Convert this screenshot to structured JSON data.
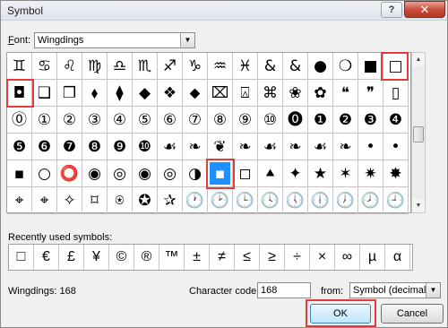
{
  "window": {
    "title": "Symbol",
    "help_label": "?",
    "close_label": "✕"
  },
  "font": {
    "label_accel": "F",
    "label_rest": "ont:",
    "value": "Wingdings",
    "dropdown_arrow": "▼"
  },
  "grid": {
    "rows": [
      [
        "♊",
        "♋",
        "♌",
        "♍",
        "♎",
        "♏",
        "♐",
        "♑",
        "♒",
        "♓",
        "&",
        "&",
        "●",
        "❍",
        "■",
        "□"
      ],
      [
        "◘",
        "❑",
        "❒",
        "⬧",
        "⧫",
        "◆",
        "❖",
        "⬥",
        "⌧",
        "⍓",
        "⌘",
        "❀",
        "✿",
        "❝",
        "❞",
        "▯"
      ],
      [
        "⓪",
        "①",
        "②",
        "③",
        "④",
        "⑤",
        "⑥",
        "⑦",
        "⑧",
        "⑨",
        "⑩",
        "⓿",
        "❶",
        "❷",
        "❸",
        "❹"
      ],
      [
        "❺",
        "❻",
        "❼",
        "❽",
        "❾",
        "❿",
        "☙",
        "❧",
        "❦",
        "❧",
        "☙",
        "❧",
        "☙",
        "❧",
        "•",
        "•"
      ],
      [
        "▪",
        "○",
        "⭕",
        "◉",
        "◎",
        "◉",
        "◎",
        "◑",
        "▪",
        "◻",
        "⯅",
        "✦",
        "★",
        "✶",
        "✷",
        "✸",
        "✹"
      ],
      [
        "⌖",
        "⌖",
        "✧",
        "⌑",
        "⍟",
        "✪",
        "✰",
        "🕐",
        "🕑",
        "🕒",
        "🕓",
        "🕔",
        "🕕",
        "🕖",
        "🕗",
        "🕘"
      ]
    ],
    "selected": {
      "row": 4,
      "col": 8
    }
  },
  "scrollbar": {
    "up_arrow": "▲",
    "down_arrow": "▼"
  },
  "recent": {
    "label": "Recently used symbols:",
    "symbols": [
      "□",
      "€",
      "£",
      "¥",
      "©",
      "®",
      "™",
      "±",
      "≠",
      "≤",
      "≥",
      "÷",
      "×",
      "∞",
      "µ",
      "α"
    ]
  },
  "status": {
    "font_info": "Wingdings: 168",
    "char_code_label": "Character code:",
    "char_code_value": "168",
    "from_label": "from:",
    "from_value": "Symbol (decimal)",
    "dropdown_arrow": "▼"
  },
  "buttons": {
    "ok": "OK",
    "cancel": "Cancel"
  }
}
